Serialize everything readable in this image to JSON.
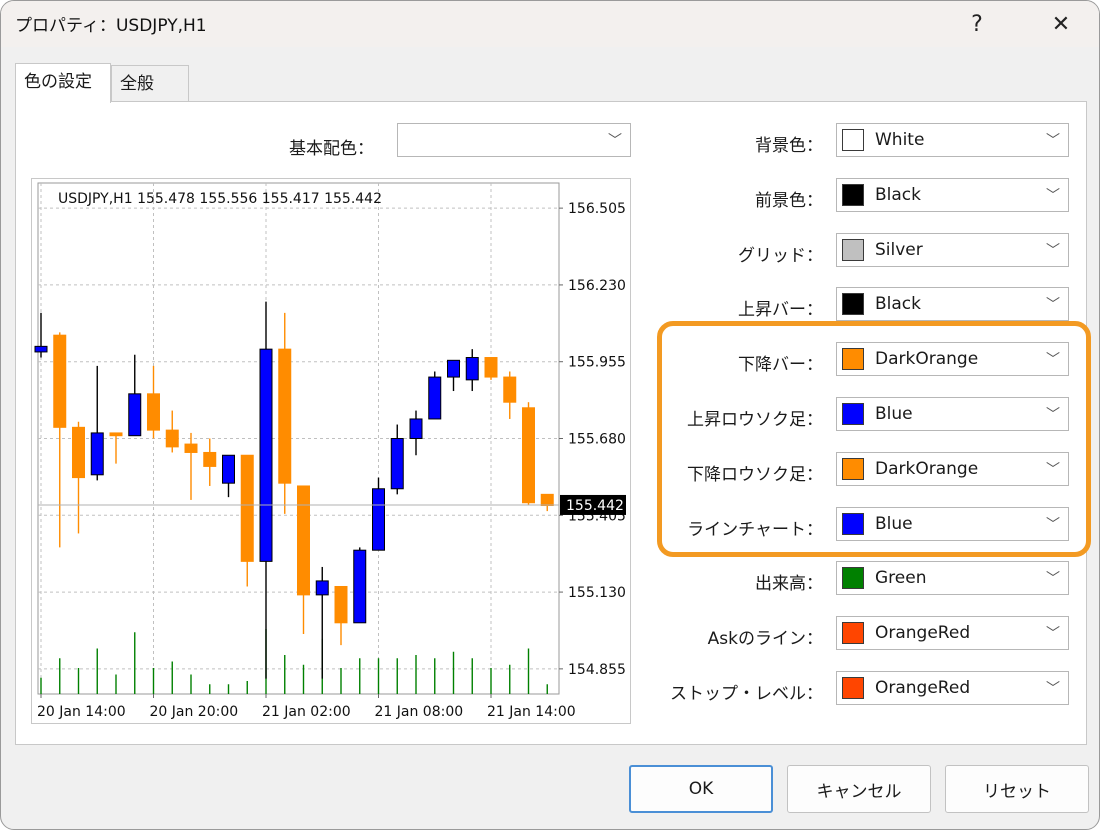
{
  "window": {
    "title": "プロパティ：USDJPY,H1",
    "help_glyph": "?",
    "close_glyph": "✕"
  },
  "tabs": [
    {
      "label": "色の設定"
    },
    {
      "label": "全般"
    }
  ],
  "base_color": {
    "label": "基本配色：",
    "value": ""
  },
  "color_rows": [
    {
      "label": "背景色：",
      "color_name": "White",
      "color": "#ffffff"
    },
    {
      "label": "前景色：",
      "color_name": "Black",
      "color": "#000000"
    },
    {
      "label": "グリッド：",
      "color_name": "Silver",
      "color": "#c0c0c0"
    },
    {
      "label": "上昇バー：",
      "color_name": "Black",
      "color": "#000000"
    },
    {
      "label": "下降バー：",
      "color_name": "DarkOrange",
      "color": "#ff8c00"
    },
    {
      "label": "上昇ロウソク足：",
      "color_name": "Blue",
      "color": "#0000ff"
    },
    {
      "label": "下降ロウソク足：",
      "color_name": "DarkOrange",
      "color": "#ff8c00"
    },
    {
      "label": "ラインチャート：",
      "color_name": "Blue",
      "color": "#0000ff"
    },
    {
      "label": "出来高：",
      "color_name": "Green",
      "color": "#008000"
    },
    {
      "label": "Askのライン：",
      "color_name": "OrangeRed",
      "color": "#ff4500"
    },
    {
      "label": "ストップ・レベル：",
      "color_name": "OrangeRed",
      "color": "#ff4500"
    }
  ],
  "buttons": {
    "ok": "OK",
    "cancel": "キャンセル",
    "reset": "リセット"
  },
  "highlight_color": "#f39a22",
  "chart_data": {
    "type": "candlestick",
    "title": "USDJPY,H1  155.478 155.556 155.417 155.442",
    "ylim": [
      154.765,
      156.595
    ],
    "y_ticks": [
      "156.505",
      "156.230",
      "155.955",
      "155.680",
      "155.405",
      "155.130",
      "154.855"
    ],
    "x_ticks": [
      "20 Jan 14:00",
      "20 Jan 20:00",
      "21 Jan 02:00",
      "21 Jan 08:00",
      "21 Jan 14:00"
    ],
    "current_price": "155.442",
    "up_color": "#0000ff",
    "down_color": "#ff8c00",
    "volume_color": "#008000",
    "candles": [
      {
        "o": 155.99,
        "h": 156.13,
        "l": 155.97,
        "c": 156.01
      },
      {
        "o": 156.05,
        "h": 156.06,
        "l": 155.29,
        "c": 155.72
      },
      {
        "o": 155.72,
        "h": 155.74,
        "l": 155.34,
        "c": 155.54
      },
      {
        "o": 155.55,
        "h": 155.94,
        "l": 155.53,
        "c": 155.7
      },
      {
        "o": 155.7,
        "h": 155.7,
        "l": 155.59,
        "c": 155.69
      },
      {
        "o": 155.69,
        "h": 155.98,
        "l": 155.69,
        "c": 155.84
      },
      {
        "o": 155.84,
        "h": 155.94,
        "l": 155.68,
        "c": 155.71
      },
      {
        "o": 155.71,
        "h": 155.78,
        "l": 155.63,
        "c": 155.65
      },
      {
        "o": 155.66,
        "h": 155.7,
        "l": 155.46,
        "c": 155.63
      },
      {
        "o": 155.63,
        "h": 155.68,
        "l": 155.51,
        "c": 155.58
      },
      {
        "o": 155.52,
        "h": 155.62,
        "l": 155.47,
        "c": 155.62
      },
      {
        "o": 155.62,
        "h": 155.62,
        "l": 155.15,
        "c": 155.24
      },
      {
        "o": 155.24,
        "h": 156.17,
        "l": 154.82,
        "c": 156.0
      },
      {
        "o": 156.0,
        "h": 156.13,
        "l": 155.41,
        "c": 155.52
      },
      {
        "o": 155.51,
        "h": 155.51,
        "l": 154.98,
        "c": 155.12
      },
      {
        "o": 155.12,
        "h": 155.22,
        "l": 154.82,
        "c": 155.17
      },
      {
        "o": 155.15,
        "h": 155.15,
        "l": 154.94,
        "c": 155.02
      },
      {
        "o": 155.02,
        "h": 155.29,
        "l": 155.02,
        "c": 155.28
      },
      {
        "o": 155.28,
        "h": 155.54,
        "l": 155.28,
        "c": 155.5
      },
      {
        "o": 155.5,
        "h": 155.73,
        "l": 155.48,
        "c": 155.68
      },
      {
        "o": 155.68,
        "h": 155.78,
        "l": 155.62,
        "c": 155.75
      },
      {
        "o": 155.75,
        "h": 155.92,
        "l": 155.75,
        "c": 155.9
      },
      {
        "o": 155.9,
        "h": 155.96,
        "l": 155.85,
        "c": 155.96
      },
      {
        "o": 155.89,
        "h": 156.0,
        "l": 155.85,
        "c": 155.97
      },
      {
        "o": 155.97,
        "h": 155.97,
        "l": 155.89,
        "c": 155.9
      },
      {
        "o": 155.9,
        "h": 155.92,
        "l": 155.75,
        "c": 155.81
      },
      {
        "o": 155.79,
        "h": 155.81,
        "l": 155.44,
        "c": 155.45
      },
      {
        "o": 155.48,
        "h": 155.48,
        "l": 155.42,
        "c": 155.44
      }
    ],
    "volumes": [
      0.25,
      0.55,
      0.4,
      0.7,
      0.3,
      0.95,
      0.4,
      0.5,
      0.3,
      0.15,
      0.15,
      0.2,
      1.0,
      0.6,
      0.45,
      0.85,
      0.4,
      0.55,
      0.55,
      0.55,
      0.6,
      0.55,
      0.65,
      0.55,
      0.4,
      0.45,
      0.7,
      0.15
    ]
  }
}
